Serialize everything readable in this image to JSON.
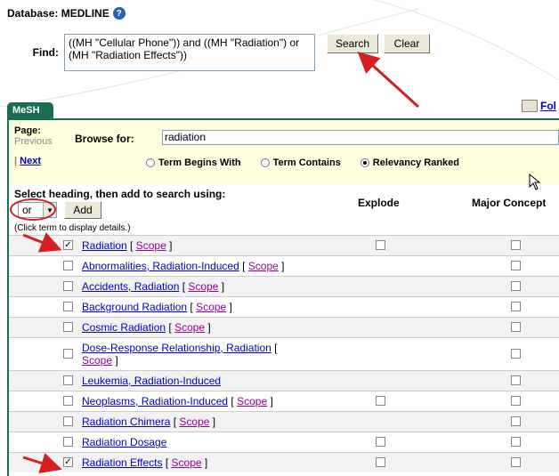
{
  "header": {
    "database_label": "Database: MEDLINE",
    "help_icon": "question-icon"
  },
  "find": {
    "label": "Find:",
    "query": "((MH \"Cellular Phone\")) and ((MH \"Radiation\") or (MH \"Radiation Effects\"))",
    "search_label": "Search",
    "clear_label": "Clear"
  },
  "tab": {
    "label": "MeSH"
  },
  "folder": {
    "icon": "folder-icon",
    "label": "Fol"
  },
  "browse": {
    "page_label": "Page:",
    "previous_label": "Previous",
    "next_sep": "| ",
    "next_label": "Next",
    "browse_for_label": "Browse for:",
    "browse_value": "radiation",
    "radio_options": [
      "Term Begins With",
      "Term Contains",
      "Relevancy Ranked"
    ],
    "selected_radio": "Relevancy Ranked"
  },
  "select": {
    "heading": "Select heading, then add to search using:",
    "operator": "or",
    "add_label": "Add",
    "hint": "(Click term to display details.)",
    "col_explode": "Explode",
    "col_major": "Major Concept"
  },
  "terms": [
    {
      "term": "Radiation",
      "scope": "Scope",
      "checked": true,
      "explode": true
    },
    {
      "term": "Abnormalities, Radiation-Induced",
      "scope": "Scope",
      "checked": false,
      "explode": false
    },
    {
      "term": "Accidents, Radiation",
      "scope": "Scope",
      "checked": false,
      "explode": false
    },
    {
      "term": "Background Radiation",
      "scope": "Scope",
      "checked": false,
      "explode": false
    },
    {
      "term": "Cosmic Radiation",
      "scope": "Scope",
      "checked": false,
      "explode": false
    },
    {
      "term": "Dose-Response Relationship, Radiation",
      "scope": "Scope",
      "checked": false,
      "explode": false
    },
    {
      "term": "Leukemia, Radiation-Induced",
      "scope": "",
      "checked": false,
      "explode": false
    },
    {
      "term": "Neoplasms, Radiation-Induced",
      "scope": "Scope",
      "checked": false,
      "explode": true
    },
    {
      "term": "Radiation Chimera",
      "scope": "Scope",
      "checked": false,
      "explode": false
    },
    {
      "term": "Radiation Dosage",
      "scope": "",
      "checked": false,
      "explode": true
    },
    {
      "term": "Radiation Effects",
      "scope": "Scope",
      "checked": true,
      "explode": true
    }
  ],
  "colors": {
    "tab": "#1a6c55",
    "link": "#0000cc",
    "scope": "#990099",
    "annotation": "#d42020",
    "browse_bg": "#ffffe0"
  }
}
